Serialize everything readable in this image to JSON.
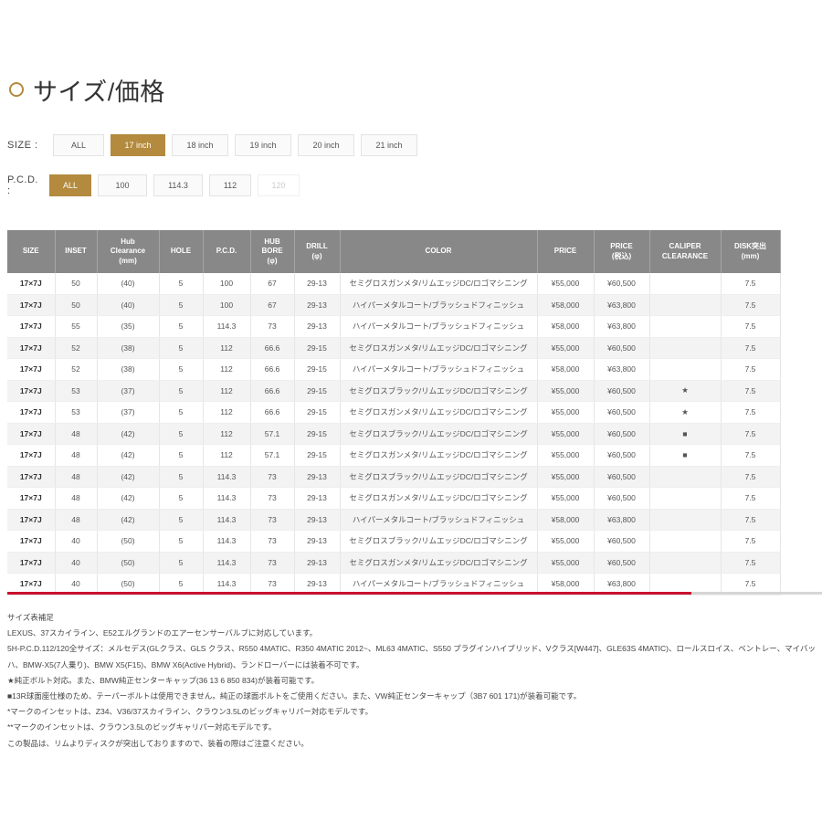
{
  "section": {
    "title": "サイズ/価格"
  },
  "filters": {
    "size_label": "SIZE :",
    "size_options": [
      {
        "label": "ALL",
        "state": "normal"
      },
      {
        "label": "17 inch",
        "state": "active"
      },
      {
        "label": "18 inch",
        "state": "normal"
      },
      {
        "label": "19 inch",
        "state": "normal"
      },
      {
        "label": "20 inch",
        "state": "normal"
      },
      {
        "label": "21 inch",
        "state": "normal"
      }
    ],
    "pcd_label": "P.C.D. :",
    "pcd_options": [
      {
        "label": "ALL",
        "state": "active"
      },
      {
        "label": "100",
        "state": "normal"
      },
      {
        "label": "114.3",
        "state": "normal"
      },
      {
        "label": "112",
        "state": "normal"
      },
      {
        "label": "120",
        "state": "disabled"
      }
    ]
  },
  "table": {
    "headers": [
      "SIZE",
      "INSET",
      "Hub\nClearance\n(mm)",
      "HOLE",
      "P.C.D.",
      "HUB\nBORE\n(φ)",
      "DRILL\n(φ)",
      "COLOR",
      "PRICE",
      "PRICE\n(税込)",
      "CALIPER\nCLEARANCE",
      "DISK突出\n(mm)"
    ],
    "rows": [
      [
        "17×7J",
        "50",
        "(40)",
        "5",
        "100",
        "67",
        "29-13",
        "セミグロスガンメタ/リムエッジDC/ロゴマシニング",
        "¥55,000",
        "¥60,500",
        "",
        "7.5"
      ],
      [
        "17×7J",
        "50",
        "(40)",
        "5",
        "100",
        "67",
        "29-13",
        "ハイパーメタルコート/ブラッシュドフィニッシュ",
        "¥58,000",
        "¥63,800",
        "",
        "7.5"
      ],
      [
        "17×7J",
        "55",
        "(35)",
        "5",
        "114.3",
        "73",
        "29-13",
        "ハイパーメタルコート/ブラッシュドフィニッシュ",
        "¥58,000",
        "¥63,800",
        "",
        "7.5"
      ],
      [
        "17×7J",
        "52",
        "(38)",
        "5",
        "112",
        "66.6",
        "29-15",
        "セミグロスガンメタ/リムエッジDC/ロゴマシニング",
        "¥55,000",
        "¥60,500",
        "",
        "7.5"
      ],
      [
        "17×7J",
        "52",
        "(38)",
        "5",
        "112",
        "66.6",
        "29-15",
        "ハイパーメタルコート/ブラッシュドフィニッシュ",
        "¥58,000",
        "¥63,800",
        "",
        "7.5"
      ],
      [
        "17×7J",
        "53",
        "(37)",
        "5",
        "112",
        "66.6",
        "29-15",
        "セミグロスブラック/リムエッジDC/ロゴマシニング",
        "¥55,000",
        "¥60,500",
        "★",
        "7.5"
      ],
      [
        "17×7J",
        "53",
        "(37)",
        "5",
        "112",
        "66.6",
        "29-15",
        "セミグロスガンメタ/リムエッジDC/ロゴマシニング",
        "¥55,000",
        "¥60,500",
        "★",
        "7.5"
      ],
      [
        "17×7J",
        "48",
        "(42)",
        "5",
        "112",
        "57.1",
        "29-15",
        "セミグロスブラック/リムエッジDC/ロゴマシニング",
        "¥55,000",
        "¥60,500",
        "■",
        "7.5"
      ],
      [
        "17×7J",
        "48",
        "(42)",
        "5",
        "112",
        "57.1",
        "29-15",
        "セミグロスガンメタ/リムエッジDC/ロゴマシニング",
        "¥55,000",
        "¥60,500",
        "■",
        "7.5"
      ],
      [
        "17×7J",
        "48",
        "(42)",
        "5",
        "114.3",
        "73",
        "29-13",
        "セミグロスブラック/リムエッジDC/ロゴマシニング",
        "¥55,000",
        "¥60,500",
        "",
        "7.5"
      ],
      [
        "17×7J",
        "48",
        "(42)",
        "5",
        "114.3",
        "73",
        "29-13",
        "セミグロスガンメタ/リムエッジDC/ロゴマシニング",
        "¥55,000",
        "¥60,500",
        "",
        "7.5"
      ],
      [
        "17×7J",
        "48",
        "(42)",
        "5",
        "114.3",
        "73",
        "29-13",
        "ハイパーメタルコート/ブラッシュドフィニッシュ",
        "¥58,000",
        "¥63,800",
        "",
        "7.5"
      ],
      [
        "17×7J",
        "40",
        "(50)",
        "5",
        "114.3",
        "73",
        "29-13",
        "セミグロスブラック/リムエッジDC/ロゴマシニング",
        "¥55,000",
        "¥60,500",
        "",
        "7.5"
      ],
      [
        "17×7J",
        "40",
        "(50)",
        "5",
        "114.3",
        "73",
        "29-13",
        "セミグロスガンメタ/リムエッジDC/ロゴマシニング",
        "¥55,000",
        "¥60,500",
        "",
        "7.5"
      ],
      [
        "17×7J",
        "40",
        "(50)",
        "5",
        "114.3",
        "73",
        "29-13",
        "ハイパーメタルコート/ブラッシュドフィニッシュ",
        "¥58,000",
        "¥63,800",
        "",
        "7.5"
      ]
    ]
  },
  "scroll_progress": 0.84,
  "colors": {
    "accent": "#b38a3e",
    "header_bg": "#888888",
    "progress": "#c8102e"
  },
  "notes": [
    "サイズ表補足",
    "LEXUS、37スカイライン、E52エルグランドのエアーセンサーバルブに対応しています。",
    "5H-P.C.D.112/120全サイズ：メルセデス(GLクラス、GLS クラス、R550 4MATIC、R350 4MATIC 2012~、ML63 4MATIC、S550 プラグインハイブリッド、Vクラス[W447]、GLE63S 4MATIC)、ロールスロイス、ベントレー、マイバッハ、BMW-X5(7人乗り)、BMW X5(F15)、BMW X6(Active Hybrid)、ランドローバーには装着不可です。",
    "★純正ボルト対応。また、BMW純正センターキャップ(36 13 6 850 834)が装着可能です。",
    "■13R球面座仕様のため、テーパーボルトは使用できません。純正の球面ボルトをご使用ください。また、VW純正センターキャップ（3B7 601 171)が装着可能です。",
    "*マークのインセットは、Z34、V36/37スカイライン、クラウン3.5Lのビッグキャリパー対応モデルです。",
    "**マークのインセットは、クラウン3.5Lのビッグキャリパー対応モデルです。",
    "この製品は、リムよりディスクが突出しておりますので、装着の際はご注意ください。"
  ]
}
